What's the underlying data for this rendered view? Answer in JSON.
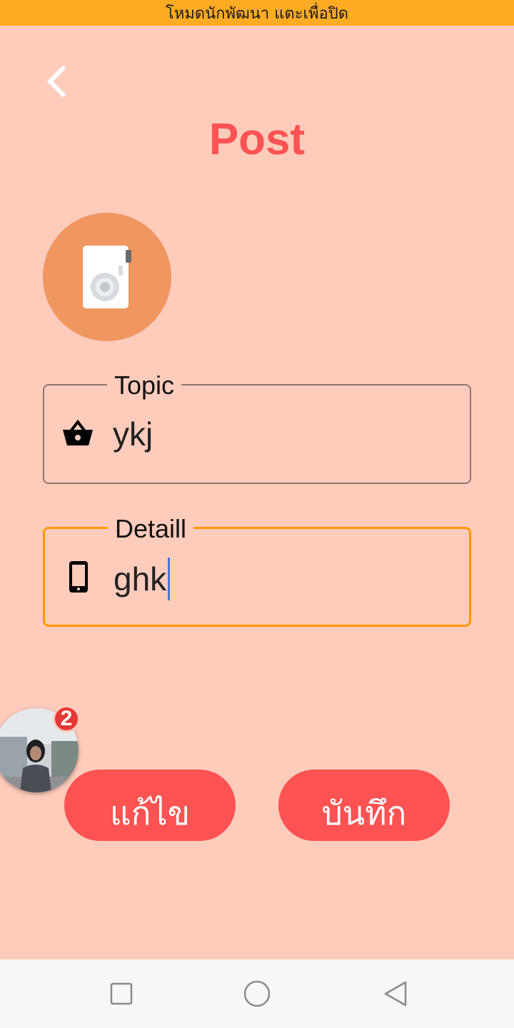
{
  "status_banner": {
    "text": "โหมดนักพัฒนา แตะเพื่อปิด"
  },
  "header": {
    "title": "Post",
    "back_icon": "chevron-left-icon"
  },
  "image_picker": {
    "icon": "camera-icon",
    "color": "#F09660"
  },
  "form": {
    "topic": {
      "label": "Topic",
      "value": "ykj",
      "icon": "shopping-basket-icon"
    },
    "detail": {
      "label": "Detaill",
      "value": "ghk",
      "icon": "smartphone-icon"
    }
  },
  "chat_head": {
    "badge_count": "2"
  },
  "actions": {
    "edit_label": "แก้ไข",
    "save_label": "บันทึก"
  },
  "nav_bar": {
    "recents_icon": "square-icon",
    "home_icon": "circle-icon",
    "back_icon": "triangle-back-icon"
  },
  "colors": {
    "background": "#FFCCBC",
    "accent": "#FF5252",
    "banner": "#FFAB24",
    "focus": "#FF9800"
  }
}
